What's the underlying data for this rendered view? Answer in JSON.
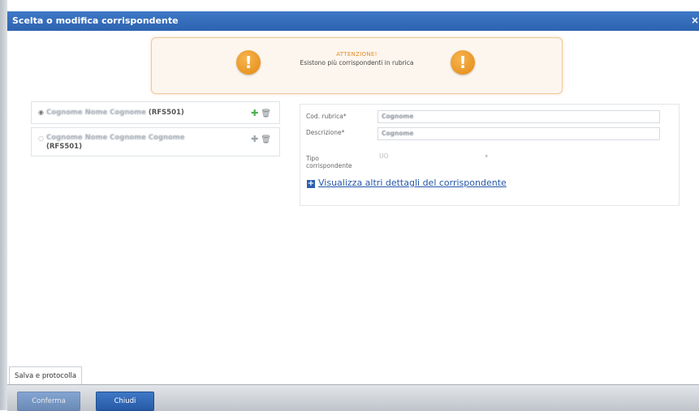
{
  "dialog": {
    "title": "Scelta o modifica corrispondente",
    "close_symbol": "×"
  },
  "alert": {
    "heading": "ATTENZIONE!",
    "message": "Esistono più corrispondenti in rubrica",
    "icon": "warning-icon",
    "icon_glyph": "!"
  },
  "correspondents": [
    {
      "radio": "◉",
      "name_blurred": "Cognome Nome Cognome",
      "code": "(RFS501)"
    },
    {
      "radio": "◌",
      "name_blurred": "Cognome Nome Cognome Cognome",
      "code": "(RFS501)"
    }
  ],
  "icons": {
    "add": "✚",
    "delete": "🗑"
  },
  "detail": {
    "cod_rubrica_label": "Cod. rubrica*",
    "cod_rubrica_value": "Cognome",
    "descrizione_label": "Descrizione*",
    "descrizione_value": "Cognome",
    "tipo_label": "Tipo corrispondente",
    "tipo_value": "UO",
    "tipo_chevron": "▾",
    "more_link": "Visualizza altri dettagli del corrispondente",
    "more_icon": "+"
  },
  "tabs": {
    "salva": "Salva e protocolla"
  },
  "footer": {
    "confirm": "Conferma",
    "close": "Chiudi"
  },
  "colors": {
    "accent": "#2d63b0",
    "warning": "#e38a12",
    "add": "#4caf50"
  }
}
